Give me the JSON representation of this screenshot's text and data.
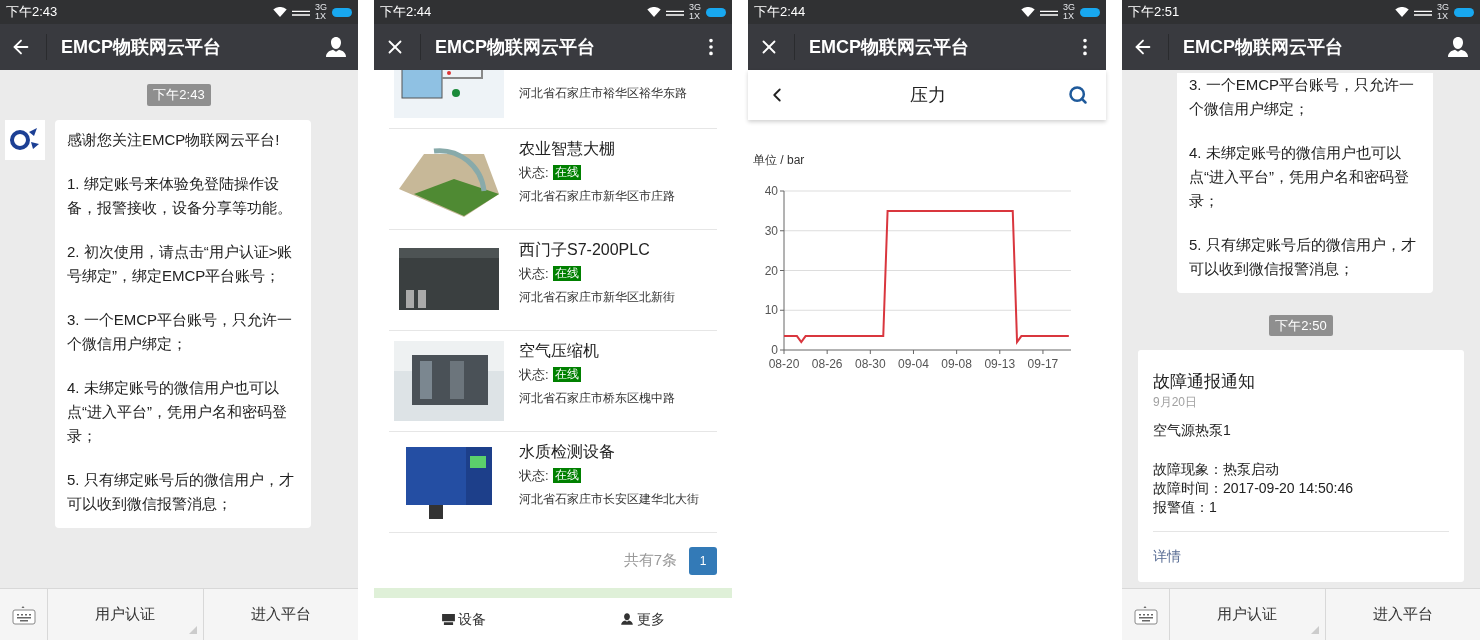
{
  "screens": [
    {
      "kind": "chat",
      "status_bar": {
        "time": "下午2:43",
        "network": [
          "3G",
          "1X"
        ]
      },
      "header": {
        "title": "EMCP物联网云平台"
      },
      "messages": [
        {
          "kind": "time",
          "text": "下午2:43"
        },
        {
          "kind": "bubble",
          "avatar": true,
          "paragraphs": [
            "感谢您关注EMCP物联网云平台!",
            "1. 绑定账号来体验免登陆操作设备，报警接收，设备分享等功能。",
            "2. 初次使用，请点击“用户认证>账号绑定”，绑定EMCP平台账号；",
            "3. 一个EMCP平台账号，只允许一个微信用户绑定；",
            "4. 未绑定账号的微信用户也可以点“进入平台”，凭用户名和密码登录；",
            "5. 只有绑定账号后的微信用户，才可以收到微信报警消息；"
          ]
        }
      ],
      "menu": [
        {
          "label": "用户认证",
          "submenu": true
        },
        {
          "label": "进入平台",
          "submenu": false
        }
      ]
    },
    {
      "kind": "device_list",
      "status_bar": {
        "time": "下午2:44",
        "network": [
          "3G",
          "1X"
        ]
      },
      "header": {
        "title": "EMCP物联网云平台"
      },
      "devices": [
        {
          "address": "河北省石家庄市裕华区裕华东路"
        },
        {
          "name": "农业智慧大棚",
          "status_label": "状态:",
          "status": "在线",
          "address": "河北省石家庄市新华区市庄路"
        },
        {
          "name": "西门子S7-200PLC",
          "status_label": "状态:",
          "status": "在线",
          "address": "河北省石家庄市新华区北新街"
        },
        {
          "name": "空气压缩机",
          "status_label": "状态:",
          "status": "在线",
          "address": "河北省石家庄市桥东区槐中路"
        },
        {
          "name": "水质检测设备",
          "status_label": "状态:",
          "status": "在线",
          "address": "河北省石家庄市长安区建华北大街"
        }
      ],
      "total": "共有7条",
      "pages": [
        {
          "label": "1",
          "selected": true
        }
      ],
      "tabs": [
        {
          "label": "设备"
        },
        {
          "label": "更多"
        }
      ]
    },
    {
      "kind": "chart",
      "status_bar": {
        "time": "下午2:44",
        "network": [
          "3G",
          "1X"
        ]
      },
      "header": {
        "title": "EMCP物联网云平台"
      },
      "subheader": {
        "title": "压力"
      },
      "unit": "单位 / bar",
      "chart_data": {
        "type": "line",
        "categories": [
          "08-20",
          null,
          null,
          null,
          null,
          null,
          null,
          null,
          null,
          null,
          "08-26",
          null,
          null,
          null,
          null,
          null,
          null,
          null,
          null,
          null,
          "08-30",
          null,
          null,
          null,
          null,
          null,
          null,
          null,
          null,
          null,
          "09-04",
          null,
          null,
          null,
          null,
          null,
          null,
          null,
          null,
          null,
          "09-08",
          null,
          null,
          null,
          null,
          null,
          null,
          null,
          null,
          null,
          "09-13",
          null,
          null,
          null,
          null,
          null,
          null,
          null,
          null,
          null,
          "09-17",
          null,
          null,
          null,
          null,
          null,
          null
        ],
        "series": [
          {
            "color": "#d9363e",
            "values": [
              3.5,
              3.5,
              3.5,
              3.5,
              2,
              3.5,
              3.5,
              3.5,
              3.5,
              3.5,
              3.5,
              3.5,
              3.5,
              3.5,
              3.5,
              3.5,
              3.5,
              3.5,
              3.5,
              3.5,
              3.5,
              3.5,
              3.5,
              3.5,
              35,
              35,
              35,
              35,
              35,
              35,
              35,
              35,
              35,
              35,
              35,
              35,
              35,
              35,
              35,
              35,
              35,
              35,
              35,
              35,
              35,
              35,
              35,
              35,
              35,
              35,
              35,
              35,
              35,
              35,
              2,
              3.5,
              3.5,
              3.5,
              3.5,
              3.5,
              3.5,
              3.5,
              3.5,
              3.5,
              3.5,
              3.5,
              3.5
            ]
          }
        ],
        "ylim": [
          0,
          40
        ],
        "yticks": [
          0,
          10,
          20,
          30,
          40
        ],
        "grid": true
      }
    },
    {
      "kind": "chat",
      "status_bar": {
        "time": "下午2:51",
        "network": [
          "3G",
          "1X"
        ]
      },
      "header": {
        "title": "EMCP物联网云平台"
      },
      "messages": [
        {
          "kind": "bubble",
          "avatar": false,
          "paragraphs": [
            "3. 一个EMCP平台账号，只允许一个微信用户绑定；",
            "4. 未绑定账号的微信用户也可以点“进入平台”，凭用户名和密码登录；",
            "5. 只有绑定账号后的微信用户，才可以收到微信报警消息；"
          ]
        },
        {
          "kind": "time",
          "text": "下午2:50"
        },
        {
          "kind": "card",
          "title": "故障通报通知",
          "date": "9月20日",
          "device": "空气源热泵1",
          "lines": [
            "故障现象：热泵启动",
            "故障时间：2017-09-20 14:50:46",
            "报警值：1"
          ],
          "link": "详情"
        }
      ],
      "menu": [
        {
          "label": "用户认证",
          "submenu": true
        },
        {
          "label": "进入平台",
          "submenu": false
        }
      ]
    }
  ]
}
